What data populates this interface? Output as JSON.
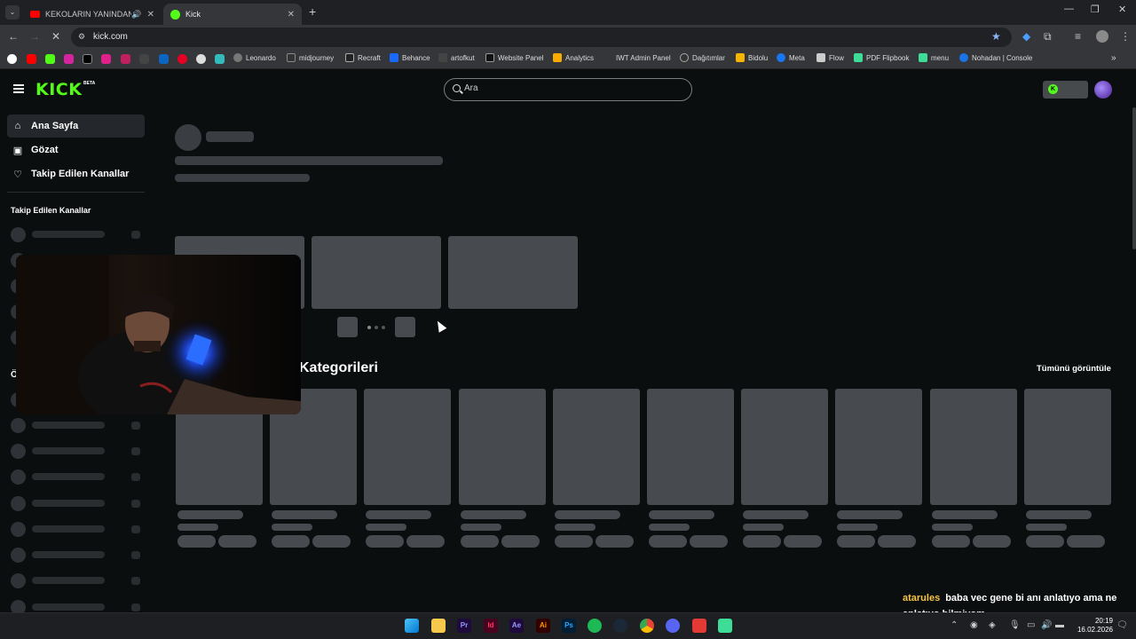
{
  "browser": {
    "tabs": [
      {
        "title": "KEKOLARIN YANINDAN KA",
        "active": false,
        "audio": true
      },
      {
        "title": "Kick",
        "active": true,
        "audio": false
      }
    ],
    "new_tab_label": "+",
    "address": "kick.com",
    "bookmarks": [
      {
        "label": "Leonardo"
      },
      {
        "label": "midjourney"
      },
      {
        "label": "Recraft"
      },
      {
        "label": "Behance"
      },
      {
        "label": "artofkut"
      },
      {
        "label": "Website Panel"
      },
      {
        "label": "Analytics"
      },
      {
        "label": "IWT Admin Panel"
      },
      {
        "label": "Dağıtımlar"
      },
      {
        "label": "Bidolu"
      },
      {
        "label": "Meta"
      },
      {
        "label": "Flow"
      },
      {
        "label": "PDF Flipbook"
      },
      {
        "label": "menu"
      },
      {
        "label": "Nohadan | Console"
      }
    ]
  },
  "kick": {
    "logo_text": "KICK",
    "logo_badge": "BETA",
    "search_placeholder": "Ara",
    "nav": [
      {
        "label": "Ana Sayfa",
        "icon": "home-icon",
        "active": true
      },
      {
        "label": "Gözat",
        "icon": "browse-icon",
        "active": false
      },
      {
        "label": "Takip Edilen Kanallar",
        "icon": "heart-icon",
        "active": false
      }
    ],
    "sidebar_heading": "Takip Edilen Kanallar",
    "sidebar_section_initial": "Ö",
    "categories_title": "Kategorileri",
    "view_all_label": "Tümünü görüntüle"
  },
  "chat": {
    "username": "atarules",
    "message": "baba vec gene bi anı anlatıyo ama ne anlatıyo bilmiyom"
  },
  "taskbar": {
    "time": "20:19",
    "date": "16.02.2026"
  },
  "colors": {
    "kick_green": "#53fc18",
    "page_bg": "#0b0e0f",
    "skeleton": "#474a4f",
    "chat_user": "#f5c542"
  }
}
